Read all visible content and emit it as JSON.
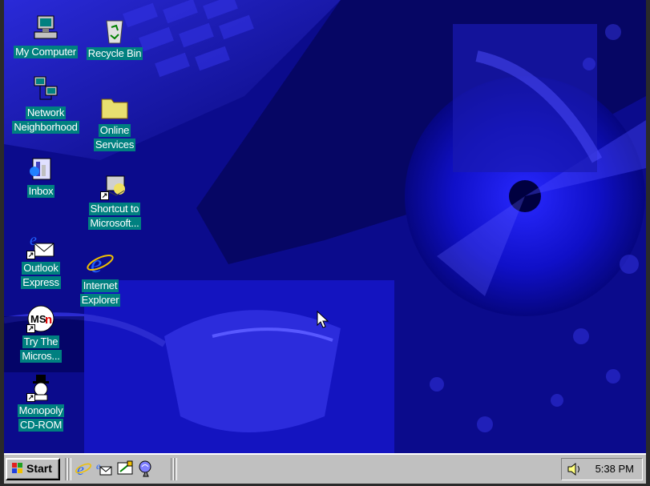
{
  "desktop": {
    "icons": [
      {
        "id": "my-computer",
        "label": "My Computer"
      },
      {
        "id": "recycle-bin",
        "label": "Recycle Bin"
      },
      {
        "id": "network-neighborhood",
        "label1": "Network",
        "label2": "Neighborhood"
      },
      {
        "id": "online-services",
        "label1": "Online",
        "label2": "Services"
      },
      {
        "id": "inbox",
        "label": "Inbox"
      },
      {
        "id": "shortcut-microsoft",
        "label1": "Shortcut to",
        "label2": "Microsoft..."
      },
      {
        "id": "outlook-express",
        "label1": "Outlook",
        "label2": "Express"
      },
      {
        "id": "internet-explorer",
        "label1": "Internet",
        "label2": "Explorer"
      },
      {
        "id": "try-msn",
        "label1": "Try The",
        "label2": "Micros..."
      },
      {
        "id": "monopoly",
        "label1": "Monopoly",
        "label2": "CD-ROM"
      }
    ],
    "label_color": "#008080",
    "wallpaper_color": "#0a0aa0"
  },
  "taskbar": {
    "start_label": "Start",
    "clock": "5:38 PM",
    "quick_launch": [
      "internet-explorer-icon",
      "outlook-express-icon",
      "show-desktop-icon",
      "channels-icon"
    ]
  }
}
